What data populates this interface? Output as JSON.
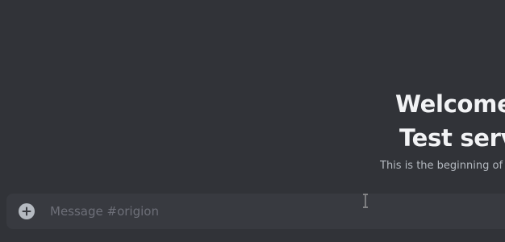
{
  "welcome": {
    "title_line1": "Welcome",
    "title_line2": "Test serv",
    "subtitle": "This is the beginning of thi"
  },
  "composer": {
    "placeholder": "Message #origion",
    "attach_icon": "plus-circle-icon"
  },
  "cursor_icon": "text-cursor-icon",
  "colors": {
    "background": "#313338",
    "composer_bg": "#383a40",
    "title": "#f2f3f5",
    "subtitle": "#b5bac1",
    "placeholder": "#6d6f78"
  }
}
